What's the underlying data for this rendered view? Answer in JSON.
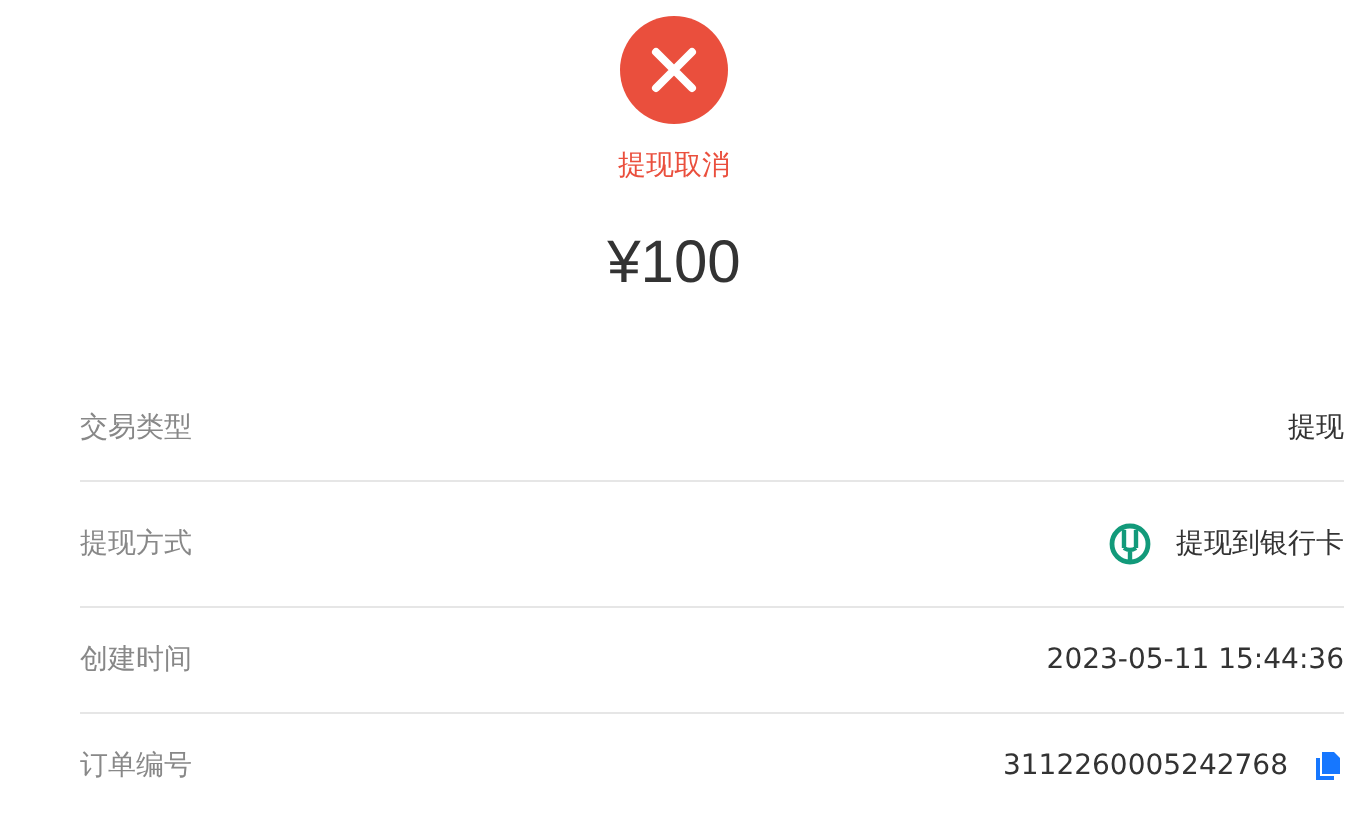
{
  "status": {
    "kind": "cancelled",
    "label": "提现取消"
  },
  "amount": "¥100",
  "rows": [
    {
      "label": "交易类型",
      "value": "提现",
      "kind": "plain"
    },
    {
      "label": "提现方式",
      "value": "提现到银行卡",
      "kind": "bank"
    },
    {
      "label": "创建时间",
      "value": "2023-05-11 15:44:36",
      "kind": "plain"
    },
    {
      "label": "订单编号",
      "value": "3112260005242768",
      "kind": "copy"
    }
  ]
}
